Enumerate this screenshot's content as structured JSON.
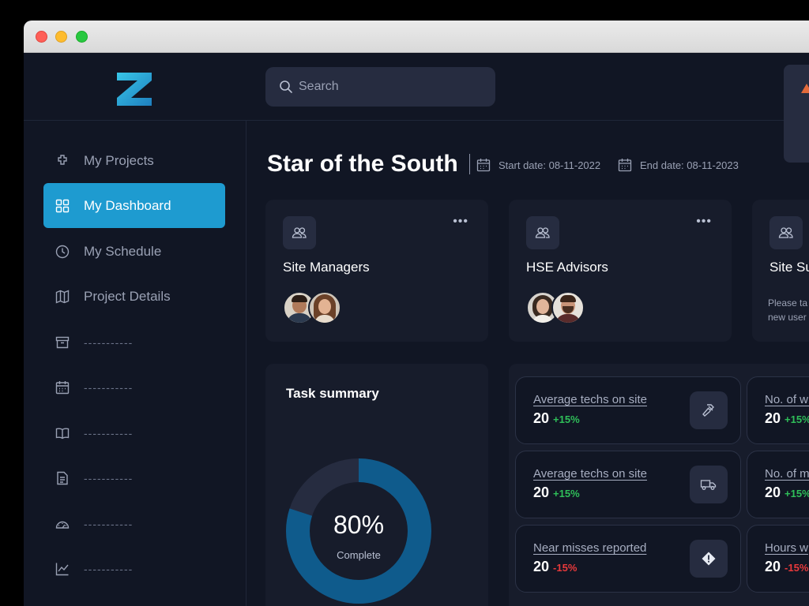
{
  "search": {
    "placeholder": "Search"
  },
  "sidebar": {
    "items": [
      {
        "label": "My Projects",
        "icon": "puzzle-icon",
        "active": false
      },
      {
        "label": "My Dashboard",
        "icon": "grid-icon",
        "active": true
      },
      {
        "label": "My Schedule",
        "icon": "clock-icon",
        "active": false
      },
      {
        "label": "Project Details",
        "icon": "map-icon",
        "active": false
      },
      {
        "label": "-----------",
        "icon": "archive-icon",
        "active": false
      },
      {
        "label": "-----------",
        "icon": "calendar-icon",
        "active": false
      },
      {
        "label": "-----------",
        "icon": "book-icon",
        "active": false
      },
      {
        "label": "-----------",
        "icon": "document-icon",
        "active": false
      },
      {
        "label": "-----------",
        "icon": "gauge-icon",
        "active": false
      },
      {
        "label": "-----------",
        "icon": "chart-icon",
        "active": false
      }
    ]
  },
  "project": {
    "title": "Star of the South",
    "start_date": "Start date: 08-11-2022",
    "end_date": "End date: 08-11-2023"
  },
  "teams": [
    {
      "title": "Site Managers",
      "more": "•••"
    },
    {
      "title": "HSE Advisors",
      "more": "•••"
    },
    {
      "title": "Site Su",
      "sub_line1": "Please ta",
      "sub_line2": "new user"
    }
  ],
  "task_summary": {
    "title": "Task summary",
    "percent_label": "80%",
    "percent": 0.8,
    "status": "Complete"
  },
  "stats": [
    {
      "label": "Average techs on site",
      "value": "20",
      "change": "+15%",
      "trend": "up",
      "icon": "hammer-icon"
    },
    {
      "label": "No. of wi",
      "value": "20",
      "change": "+15%",
      "trend": "up"
    },
    {
      "label": "Average techs on site",
      "value": "20",
      "change": "+15%",
      "trend": "up",
      "icon": "truck-icon"
    },
    {
      "label": "No. of mi",
      "value": "20",
      "change": "+15%",
      "trend": "up"
    },
    {
      "label": "Near misses reported",
      "value": "20",
      "change": "-15%",
      "trend": "down",
      "icon": "warning-diamond-icon"
    },
    {
      "label": "Hours w",
      "value": "20",
      "change": "-15%",
      "trend": "down"
    }
  ],
  "colors": {
    "accent": "#1e9bd0",
    "background": "#111624",
    "card": "#171c2b",
    "positive": "#2fbf59",
    "negative": "#e8393b",
    "donut": "#0f5b8c"
  }
}
